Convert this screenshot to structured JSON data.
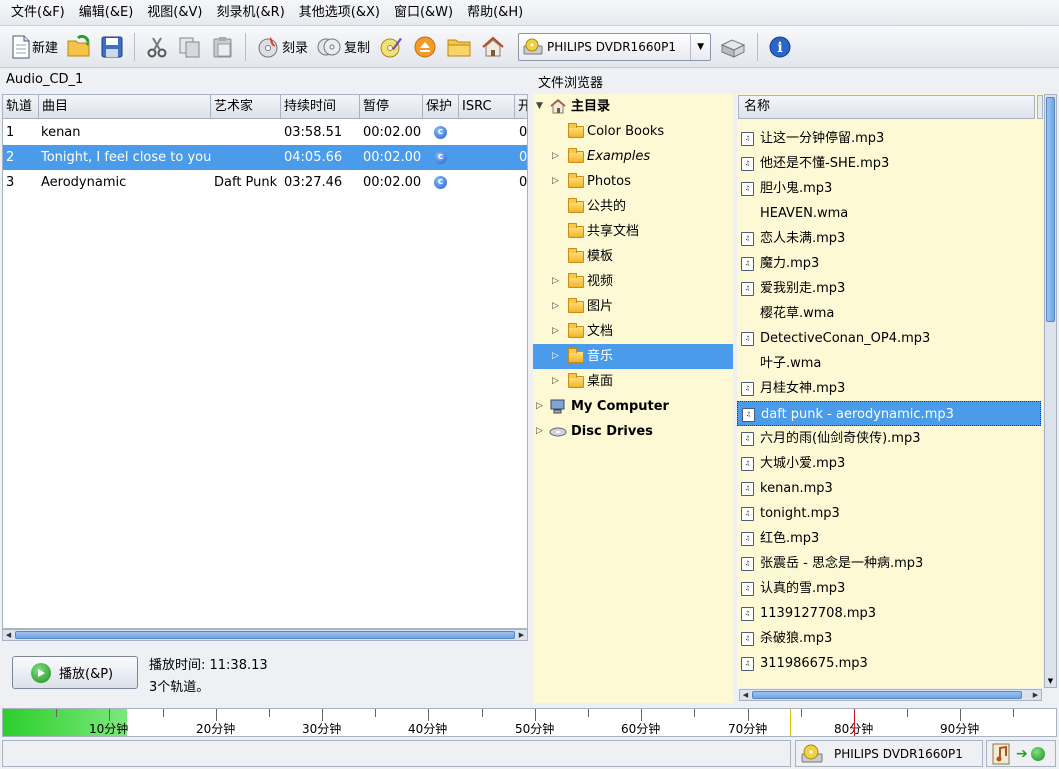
{
  "menu": [
    "文件(&F)",
    "编辑(&E)",
    "视图(&V)",
    "刻录机(&R)",
    "其他选项(&X)",
    "窗口(&W)",
    "帮助(&H)"
  ],
  "toolbar": {
    "new_label": "新建",
    "burn_label": "刻录",
    "copy_label": "复制",
    "device": "PHILIPS  DVDR1660P1"
  },
  "project": {
    "title": "Audio_CD_1",
    "columns": [
      "轨道",
      "曲目",
      "艺术家",
      "持续时间",
      "暂停",
      "保护",
      "ISRC",
      "开"
    ],
    "tracks": [
      {
        "no": "1",
        "title": "kenan",
        "artist": "",
        "duration": "03:58.51",
        "pause": "00:02.00",
        "isrc": "0"
      },
      {
        "no": "2",
        "title": "Tonight, I feel close to you",
        "artist": "",
        "duration": "04:05.66",
        "pause": "00:02.00",
        "isrc": "0"
      },
      {
        "no": "3",
        "title": "Aerodynamic",
        "artist": "Daft Punk",
        "duration": "03:27.46",
        "pause": "00:02.00",
        "isrc": "0"
      }
    ],
    "selected_track": 1,
    "play_label": "播放(&P)",
    "play_time": "播放时间: 11:38.13",
    "track_count": "3个轨道。"
  },
  "browser": {
    "title": "文件浏览器",
    "tree": [
      {
        "label": "主目录",
        "level": 0,
        "icon": "home-icon",
        "bold": true,
        "expander": "expanded"
      },
      {
        "label": "Color Books",
        "level": 1,
        "icon": "folder-icon",
        "expander": "none"
      },
      {
        "label": "Examples",
        "level": 1,
        "icon": "folder-icon",
        "expander": "collapsed",
        "italic": true
      },
      {
        "label": "Photos",
        "level": 1,
        "icon": "folder-icon",
        "expander": "collapsed"
      },
      {
        "label": "公共的",
        "level": 1,
        "icon": "folder-icon",
        "expander": "none"
      },
      {
        "label": "共享文档",
        "level": 1,
        "icon": "folder-icon",
        "expander": "none"
      },
      {
        "label": "模板",
        "level": 1,
        "icon": "folder-icon",
        "expander": "none"
      },
      {
        "label": "视频",
        "level": 1,
        "icon": "folder-icon",
        "expander": "collapsed"
      },
      {
        "label": "图片",
        "level": 1,
        "icon": "folder-icon",
        "expander": "collapsed"
      },
      {
        "label": "文档",
        "level": 1,
        "icon": "folder-icon",
        "expander": "collapsed"
      },
      {
        "label": "音乐",
        "level": 1,
        "icon": "folder-icon",
        "expander": "collapsed",
        "selected": true
      },
      {
        "label": "桌面",
        "level": 1,
        "icon": "folder-icon",
        "expander": "collapsed"
      },
      {
        "label": "My Computer",
        "level": 0,
        "icon": "computer-icon",
        "bold": true,
        "expander": "collapsed"
      },
      {
        "label": "Disc Drives",
        "level": 0,
        "icon": "disc-icon",
        "bold": true,
        "expander": "collapsed"
      }
    ],
    "files_header": "名称",
    "files": [
      {
        "name": "让这一分钟停留.mp3",
        "icon": "mp3"
      },
      {
        "name": "他还是不懂-SHE.mp3",
        "icon": "mp3"
      },
      {
        "name": "胆小鬼.mp3",
        "icon": "mp3"
      },
      {
        "name": "HEAVEN.wma",
        "icon": "none"
      },
      {
        "name": "恋人未满.mp3",
        "icon": "mp3"
      },
      {
        "name": "魔力.mp3",
        "icon": "mp3"
      },
      {
        "name": "爱我别走.mp3",
        "icon": "mp3"
      },
      {
        "name": "樱花草.wma",
        "icon": "none"
      },
      {
        "name": "DetectiveConan_OP4.mp3",
        "icon": "mp3"
      },
      {
        "name": "叶子.wma",
        "icon": "none"
      },
      {
        "name": "月桂女神.mp3",
        "icon": "mp3"
      },
      {
        "name": "daft punk - aerodynamic.mp3",
        "icon": "mp3",
        "selected": true
      },
      {
        "name": "六月的雨(仙剑奇侠传).mp3",
        "icon": "mp3"
      },
      {
        "name": "大城小爱.mp3",
        "icon": "mp3"
      },
      {
        "name": "kenan.mp3",
        "icon": "mp3"
      },
      {
        "name": "tonight.mp3",
        "icon": "mp3"
      },
      {
        "name": "红色.mp3",
        "icon": "mp3"
      },
      {
        "name": "张震岳 - 思念是一种病.mp3",
        "icon": "mp3"
      },
      {
        "name": "认真的雪.mp3",
        "icon": "mp3"
      },
      {
        "name": "1139127708.mp3",
        "icon": "mp3"
      },
      {
        "name": "杀破狼.mp3",
        "icon": "mp3"
      },
      {
        "name": "311986675.mp3",
        "icon": "mp3"
      }
    ]
  },
  "timeline": {
    "labels": [
      "10分钟",
      "20分钟",
      "30分钟",
      "40分钟",
      "50分钟",
      "60分钟",
      "70分钟",
      "80分钟",
      "90分钟"
    ],
    "used_minutes": 11.64,
    "total_minutes": 99
  },
  "status": {
    "device": "PHILIPS  DVDR1660P1"
  },
  "colors": {
    "selection": "#4a9bea",
    "browser_bg": "#fdf9d5",
    "timeline_fill": "#2ccf2c"
  }
}
